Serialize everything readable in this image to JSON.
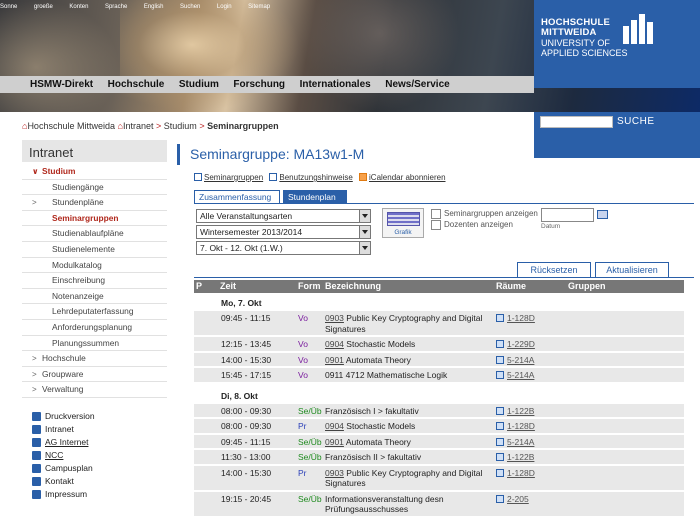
{
  "topbar": {
    "links": [
      "Sonne",
      "groeße",
      "Konten",
      "Sprache",
      "English",
      "Suchen",
      "Login",
      "Sitemap"
    ]
  },
  "logo": {
    "line1": "HOCHSCHULE",
    "line2": "MITTWEIDA",
    "line3": "UNIVERSITY OF",
    "line4": "APPLIED SCIENCES",
    "color": "#2a5fa8"
  },
  "mainnav": [
    "HSMW-Direkt",
    "Hochschule",
    "Studium",
    "Forschung",
    "Internationales",
    "News/Service"
  ],
  "breadcrumb": {
    "items": [
      "Hochschule Mittweida",
      "Intranet",
      "Studium"
    ],
    "sep": ">",
    "current": "Seminargruppen"
  },
  "search": {
    "button": "SUCHE",
    "value": ""
  },
  "sidebar": {
    "title": "Intranet",
    "items": [
      {
        "label": "Studium",
        "arrow": "∨",
        "state": "open",
        "level": 1
      },
      {
        "label": "Studiengänge",
        "level": 2
      },
      {
        "label": "Stundenpläne",
        "arrow": ">",
        "level": 2
      },
      {
        "label": "Seminargruppen",
        "level": 2,
        "state": "active"
      },
      {
        "label": "Studienablaufpläne",
        "level": 2
      },
      {
        "label": "Studienelemente",
        "level": 2
      },
      {
        "label": "Modulkatalog",
        "level": 2
      },
      {
        "label": "Einschreibung",
        "level": 2
      },
      {
        "label": "Notenanzeige",
        "level": 2
      },
      {
        "label": "Lehrdeputaterfassung",
        "level": 2
      },
      {
        "label": "Anforderungsplanung",
        "level": 2
      },
      {
        "label": "Planungssummen",
        "level": 2
      },
      {
        "label": "Hochschule",
        "arrow": ">",
        "level": 1
      },
      {
        "label": "Groupware",
        "arrow": ">",
        "level": 1
      },
      {
        "label": "Verwaltung",
        "arrow": ">",
        "level": 1
      }
    ],
    "tools": [
      {
        "label": "Druckversion",
        "icon": "printer-icon"
      },
      {
        "label": "Intranet",
        "icon": "lock-icon"
      },
      {
        "label": "AG Internet",
        "icon": "network-icon",
        "underline": true
      },
      {
        "label": "NCC",
        "icon": "ncc-icon",
        "underline": true
      },
      {
        "label": "Campusplan",
        "icon": "map-icon"
      },
      {
        "label": "Kontakt",
        "icon": "contact-icon"
      },
      {
        "label": "Impressum",
        "icon": "info-icon"
      }
    ]
  },
  "main": {
    "title": "Seminargruppe: MA13w1-M",
    "links": [
      "Seminargruppen",
      "Benutzungshinweise",
      "iCalendar abonnieren"
    ],
    "tabs": [
      "Zusammenfassung",
      "Stundenplan"
    ],
    "selects": [
      "Alle Veranstaltungsarten",
      "Wintersemester 2013/2014",
      "7. Okt - 12. Okt (1.W.)"
    ],
    "grafik_label": "Grafik",
    "checkboxes": [
      "Seminargruppen anzeigen",
      "Dozenten anzeigen"
    ],
    "date_label": "Datum",
    "date_value": "",
    "buttons": {
      "reset": "Rücksetzen",
      "update": "Aktualisieren"
    },
    "table_headers": {
      "p": "P",
      "zeit": "Zeit",
      "form": "Form",
      "bez": "Bezeichnung",
      "raum": "Räume",
      "grp": "Gruppen"
    },
    "days": [
      {
        "label": "Mo, 7. Okt",
        "rows": [
          {
            "zeit": "09:45 - 11:15",
            "form": "Vo",
            "num": "0903",
            "bez": "Public Key Cryptography and Digital Signatures",
            "raum": "1-128D"
          },
          {
            "zeit": "12:15 - 13:45",
            "form": "Vo",
            "num": "0904",
            "bez": "Stochastic Models",
            "raum": "1-229D"
          },
          {
            "zeit": "14:00 - 15:30",
            "form": "Vo",
            "num": "0901",
            "bez": "Automata Theory",
            "raum": "5-214A"
          },
          {
            "zeit": "15:45 - 17:15",
            "form": "Vo",
            "num": "",
            "bez": "0911 4712 Mathematische Logik",
            "raum": "5-214A"
          }
        ]
      },
      {
        "label": "Di, 8. Okt",
        "rows": [
          {
            "zeit": "08:00 - 09:30",
            "form": "Se/Üb",
            "num": "",
            "bez": "Französisch I > fakultativ",
            "raum": "1-122B"
          },
          {
            "zeit": "08:00 - 09:30",
            "form": "Pr",
            "num": "0904",
            "bez": "Stochastic Models",
            "raum": "1-128D"
          },
          {
            "zeit": "09:45 - 11:15",
            "form": "Se/Üb",
            "num": "0901",
            "bez": "Automata Theory",
            "raum": "5-214A"
          },
          {
            "zeit": "11:30 - 13:00",
            "form": "Se/Üb",
            "num": "",
            "bez": "Französisch II > fakultativ",
            "raum": "1-122B"
          },
          {
            "zeit": "14:00 - 15:30",
            "form": "Pr",
            "num": "0903",
            "bez": "Public Key Cryptography and Digital Signatures",
            "raum": "1-128D"
          },
          {
            "zeit": "19:15 - 20:45",
            "form": "Se/Üb",
            "num": "",
            "bez": "Informationsveranstaltung desn Prüfungsausschusses",
            "raum": "2-205"
          }
        ]
      }
    ]
  }
}
